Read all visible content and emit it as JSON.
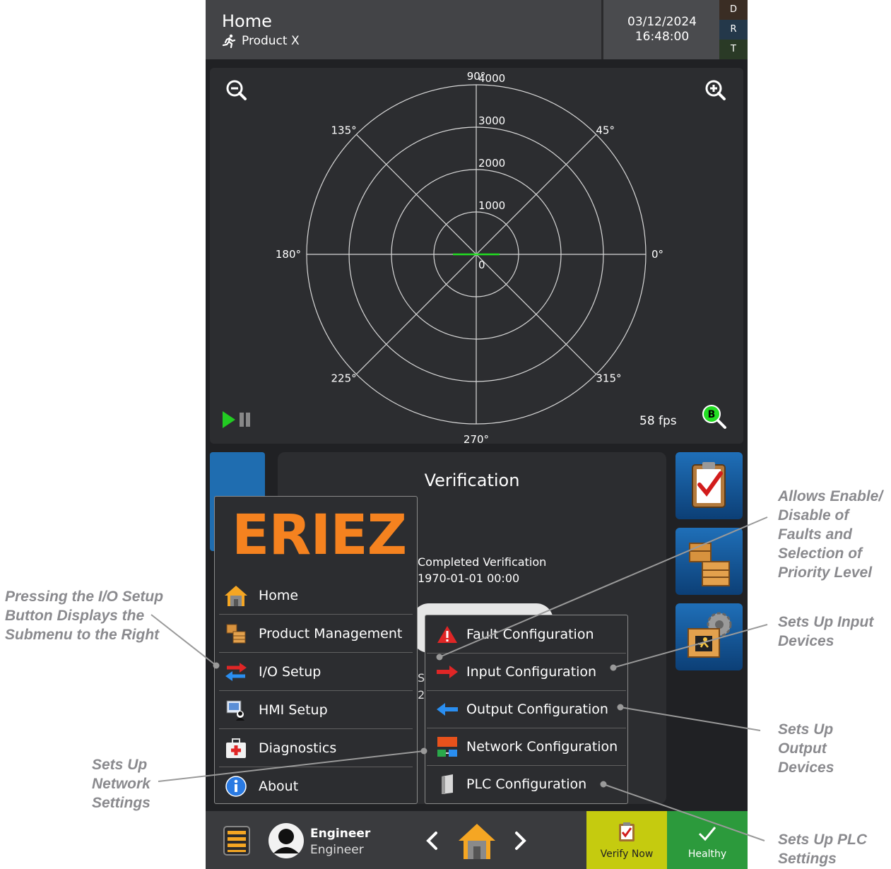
{
  "header": {
    "title": "Home",
    "product": "Product X",
    "date": "03/12/2024",
    "time": "16:48:00",
    "drt": [
      {
        "letter": "D",
        "color": "#3a2d24"
      },
      {
        "letter": "R",
        "color": "#24384a"
      },
      {
        "letter": "T",
        "color": "#2a3a26"
      }
    ]
  },
  "polar": {
    "radial_ticks": [
      "0",
      "1000",
      "2000",
      "3000",
      "4000"
    ],
    "angle_labels": {
      "a0": "0°",
      "a45": "45°",
      "a90": "90°",
      "a135": "135°",
      "a180": "180°",
      "a225": "225°",
      "a270": "270°",
      "a315": "315°"
    },
    "rmax": 4000,
    "signal_color": "#22dd22",
    "fps": "58 fps",
    "zoom_badge": "B"
  },
  "verification": {
    "title": "Verification",
    "last_line1": "Completed Verification",
    "last_line2": "1970-01-01 00:00",
    "frag1": "S",
    "frag2": "2"
  },
  "menu": {
    "logo": "ERIEZ",
    "items": [
      {
        "label": "Home",
        "icon": "home-icon"
      },
      {
        "label": "Product Management",
        "icon": "crates-icon"
      },
      {
        "label": "I/O Setup",
        "icon": "swap-arrows-icon"
      },
      {
        "label": "HMI Setup",
        "icon": "hmi-user-icon"
      },
      {
        "label": "Diagnostics",
        "icon": "first-aid-kit-icon"
      },
      {
        "label": "About",
        "icon": "info-icon"
      }
    ]
  },
  "submenu": {
    "items": [
      {
        "label": "Fault Configuration",
        "icon": "warning-icon"
      },
      {
        "label": "Input Configuration",
        "icon": "arrow-right-icon"
      },
      {
        "label": "Output Configuration",
        "icon": "arrow-left-icon"
      },
      {
        "label": "Network Configuration",
        "icon": "network-icon"
      },
      {
        "label": "PLC Configuration",
        "icon": "plc-icon"
      }
    ]
  },
  "footer": {
    "user_name": "Engineer",
    "user_role": "Engineer",
    "verify_label": "Verify Now",
    "health_label": "Healthy"
  },
  "callouts": {
    "io_setup": "Pressing the I/O Setup Button Displays the Submenu to the Right",
    "network": "Sets Up Network Settings",
    "fault": "Allows Enable/ Disable of Faults and Selection of Priority Level",
    "input": "Sets Up Input Devices",
    "output": "Sets Up Output Devices",
    "plc": "Sets Up PLC Settings"
  },
  "colors": {
    "brand_orange": "#f5821f",
    "accent_blue": "#1f6db0",
    "callout_gray": "#8a8a8e"
  }
}
